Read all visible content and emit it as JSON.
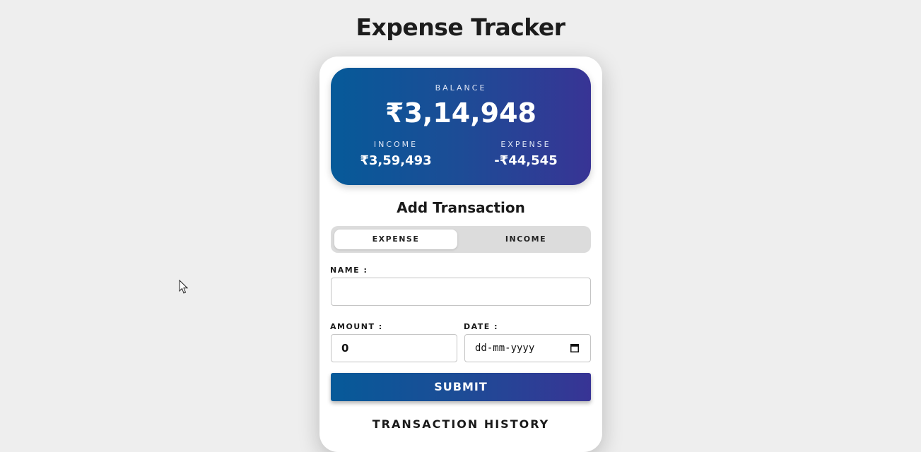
{
  "app": {
    "title": "Expense Tracker"
  },
  "balance": {
    "label": "BALANCE",
    "amount": "₹3,14,948",
    "income_label": "INCOME",
    "income_value": "₹3,59,493",
    "expense_label": "EXPENSE",
    "expense_value": "-₹44,545"
  },
  "form": {
    "title": "Add Transaction",
    "toggle": {
      "expense_label": "EXPENSE",
      "income_label": "INCOME",
      "selected": "EXPENSE"
    },
    "name_label": "NAME :",
    "name_value": "",
    "amount_label": "AMOUNT :",
    "amount_value": "0",
    "date_label": "DATE :",
    "date_placeholder": "dd-mm-yyyy",
    "submit_label": "SUBMIT"
  },
  "history": {
    "title": "TRANSACTION HISTORY"
  },
  "icons": {
    "date": "calendar-icon",
    "cursor": "mouse-pointer-icon"
  },
  "colors": {
    "background": "#eeeeee",
    "gradient_start": "#065a99",
    "gradient_end": "#383495",
    "toggle_track": "#dcdcdc"
  }
}
